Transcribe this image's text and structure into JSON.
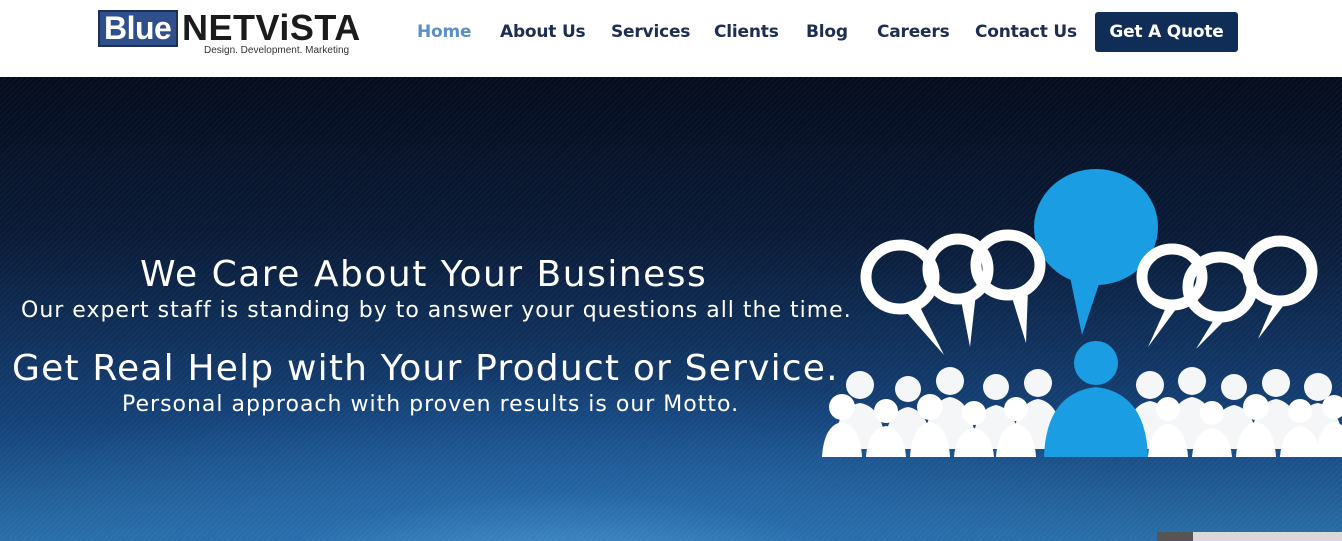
{
  "logo": {
    "part1": "Blue",
    "part2": "NETViSTA",
    "tagline": "Design. Development. Marketing"
  },
  "nav": {
    "items": [
      {
        "label": "Home",
        "active": true
      },
      {
        "label": "About Us",
        "active": false
      },
      {
        "label": "Services",
        "active": false
      },
      {
        "label": "Clients",
        "active": false
      },
      {
        "label": "Blog",
        "active": false
      },
      {
        "label": "Careers",
        "active": false
      },
      {
        "label": "Contact Us",
        "active": false
      }
    ],
    "cta_label": "Get A Quote"
  },
  "hero": {
    "heading1": "We Care About Your Business",
    "sub1": "Our expert staff is standing by to answer your questions all the time.",
    "heading2": "Get Real Help with Your Product or Service.",
    "sub2": "Personal approach with proven results is our Motto.",
    "illustration_icon": "speech-bubbles-people-icon"
  },
  "colors": {
    "brand": "#0f2d56",
    "nav_text": "#1c2e52",
    "nav_active": "#5b8fc7",
    "accent": "#1a9de3"
  }
}
